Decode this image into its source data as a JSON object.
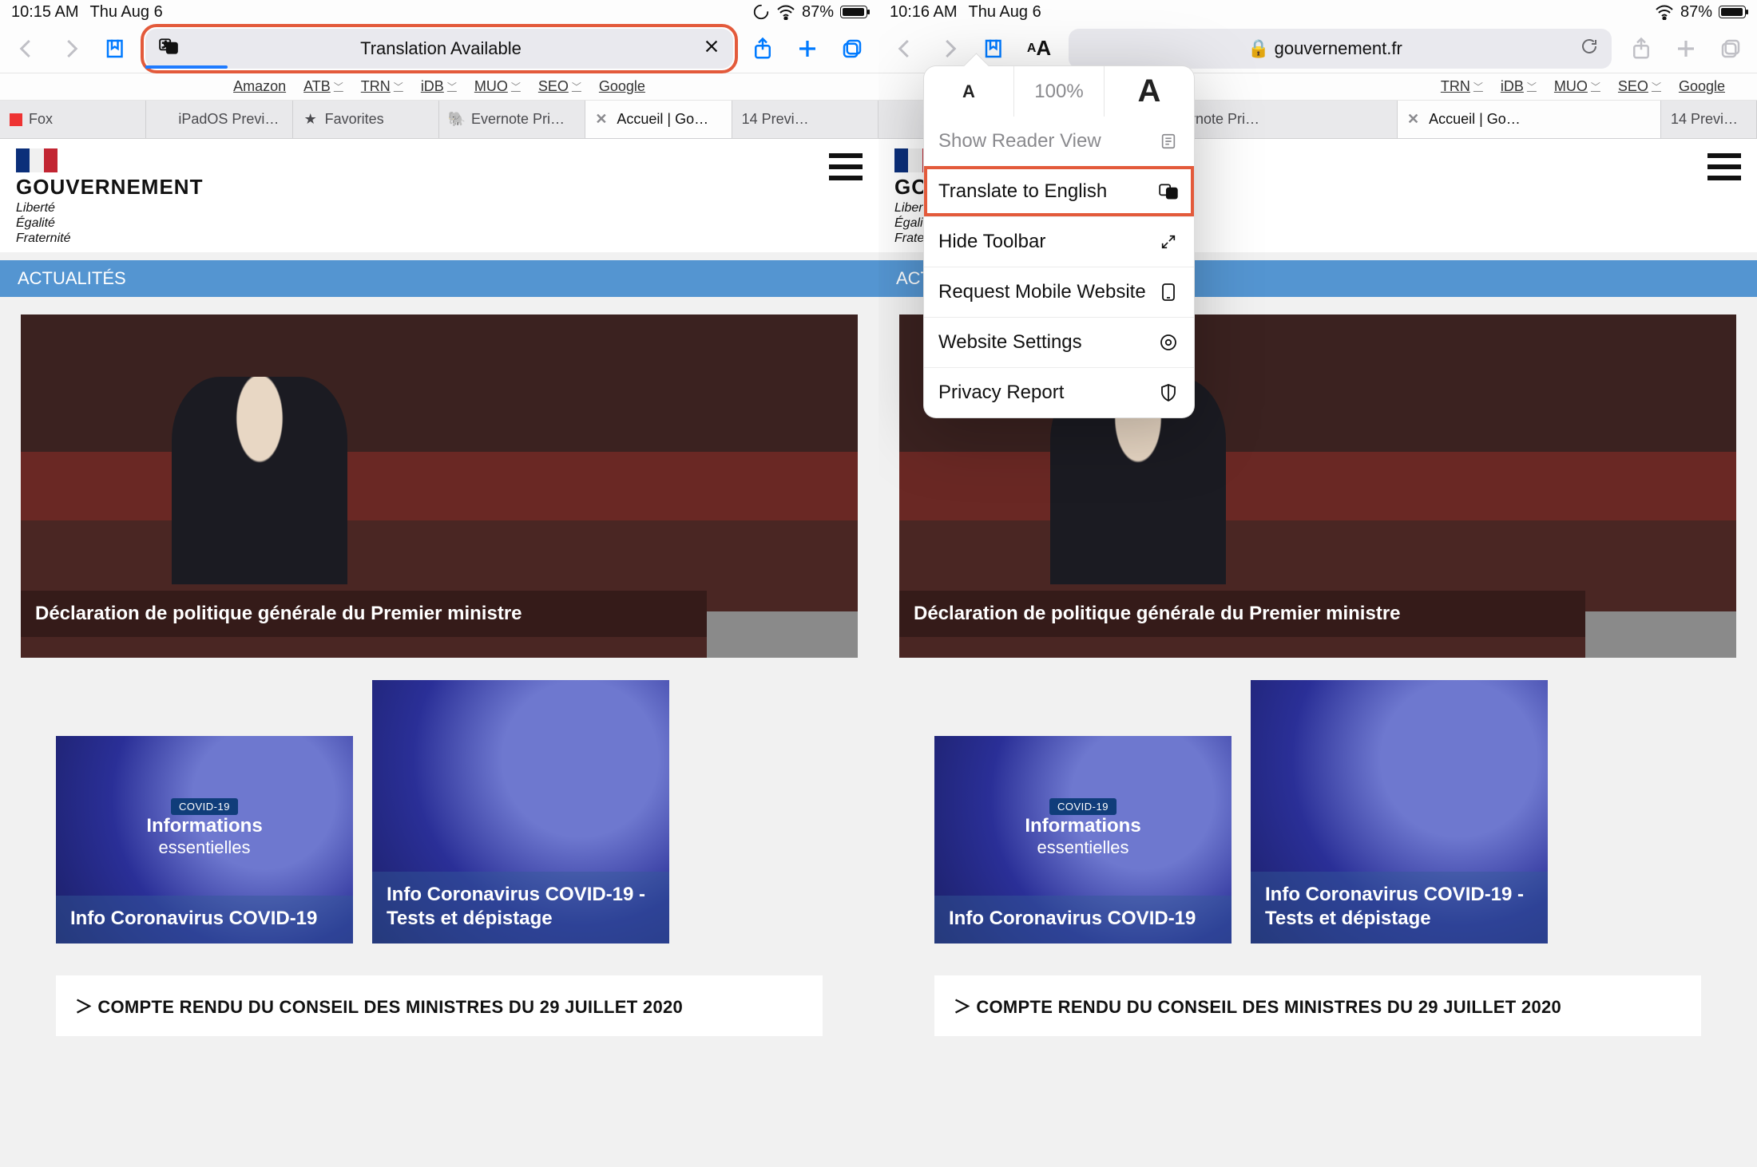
{
  "left": {
    "status": {
      "time": "10:15 AM",
      "date": "Thu Aug 6",
      "battery": "87%"
    },
    "url_pill": {
      "text": "Translation Available"
    },
    "favorites": [
      "Amazon",
      "ATB",
      "TRN",
      "iDB",
      "MUO",
      "SEO",
      "Google"
    ],
    "favorites_chevron": [
      false,
      true,
      true,
      true,
      true,
      true,
      false
    ],
    "tabs": [
      {
        "label": "Fox"
      },
      {
        "label": "iPadOS Previ…",
        "apple": true
      },
      {
        "label": "Favorites",
        "star": true
      },
      {
        "label": "Evernote Pri…",
        "ev": true
      },
      {
        "label": "Accueil | Go…",
        "active": true
      },
      {
        "label": "14 Previ…"
      }
    ]
  },
  "right": {
    "status": {
      "time": "10:16 AM",
      "date": "Thu Aug 6",
      "battery": "87%"
    },
    "url": "gouvernement.fr",
    "favorites": [
      "TRN",
      "iDB",
      "MUO",
      "SEO",
      "Google"
    ],
    "favorites_chevron": [
      true,
      true,
      true,
      true,
      false
    ],
    "tabs": [
      {
        "label": "Evernote Pri…",
        "ev": true
      },
      {
        "label": "Accueil | Go…",
        "active": true
      },
      {
        "label": "14 Previ…"
      }
    ],
    "aa_menu": {
      "percent": "100%",
      "items": [
        {
          "label": "Show Reader View"
        },
        {
          "label": "Translate to English",
          "hi": true
        },
        {
          "label": "Hide Toolbar"
        },
        {
          "label": "Request Mobile Website"
        },
        {
          "label": "Website Settings"
        },
        {
          "label": "Privacy Report"
        }
      ]
    }
  },
  "page": {
    "brand_title": "GOUVERNEMENT",
    "brand_sub1": "Liberté",
    "brand_sub2": "Égalité",
    "brand_sub3": "Fraternité",
    "section": "ACTUALITÉS",
    "hero_caption": "Déclaration de politique générale du Premier ministre",
    "tile1_badge": "COVID-19",
    "tile1_mid_top": "Informations",
    "tile1_mid_bot": "essentielles",
    "tile1_label": "Info Coronavirus COVID-19",
    "tile2_label1": "Info Coronavirus COVID-19 -",
    "tile2_label2": "Tests et dépistage",
    "linkrow": "COMPTE RENDU DU CONSEIL DES MINISTRES DU 29 JUILLET 2020"
  },
  "icons": {
    "small_a": "A",
    "big_a": "A"
  }
}
